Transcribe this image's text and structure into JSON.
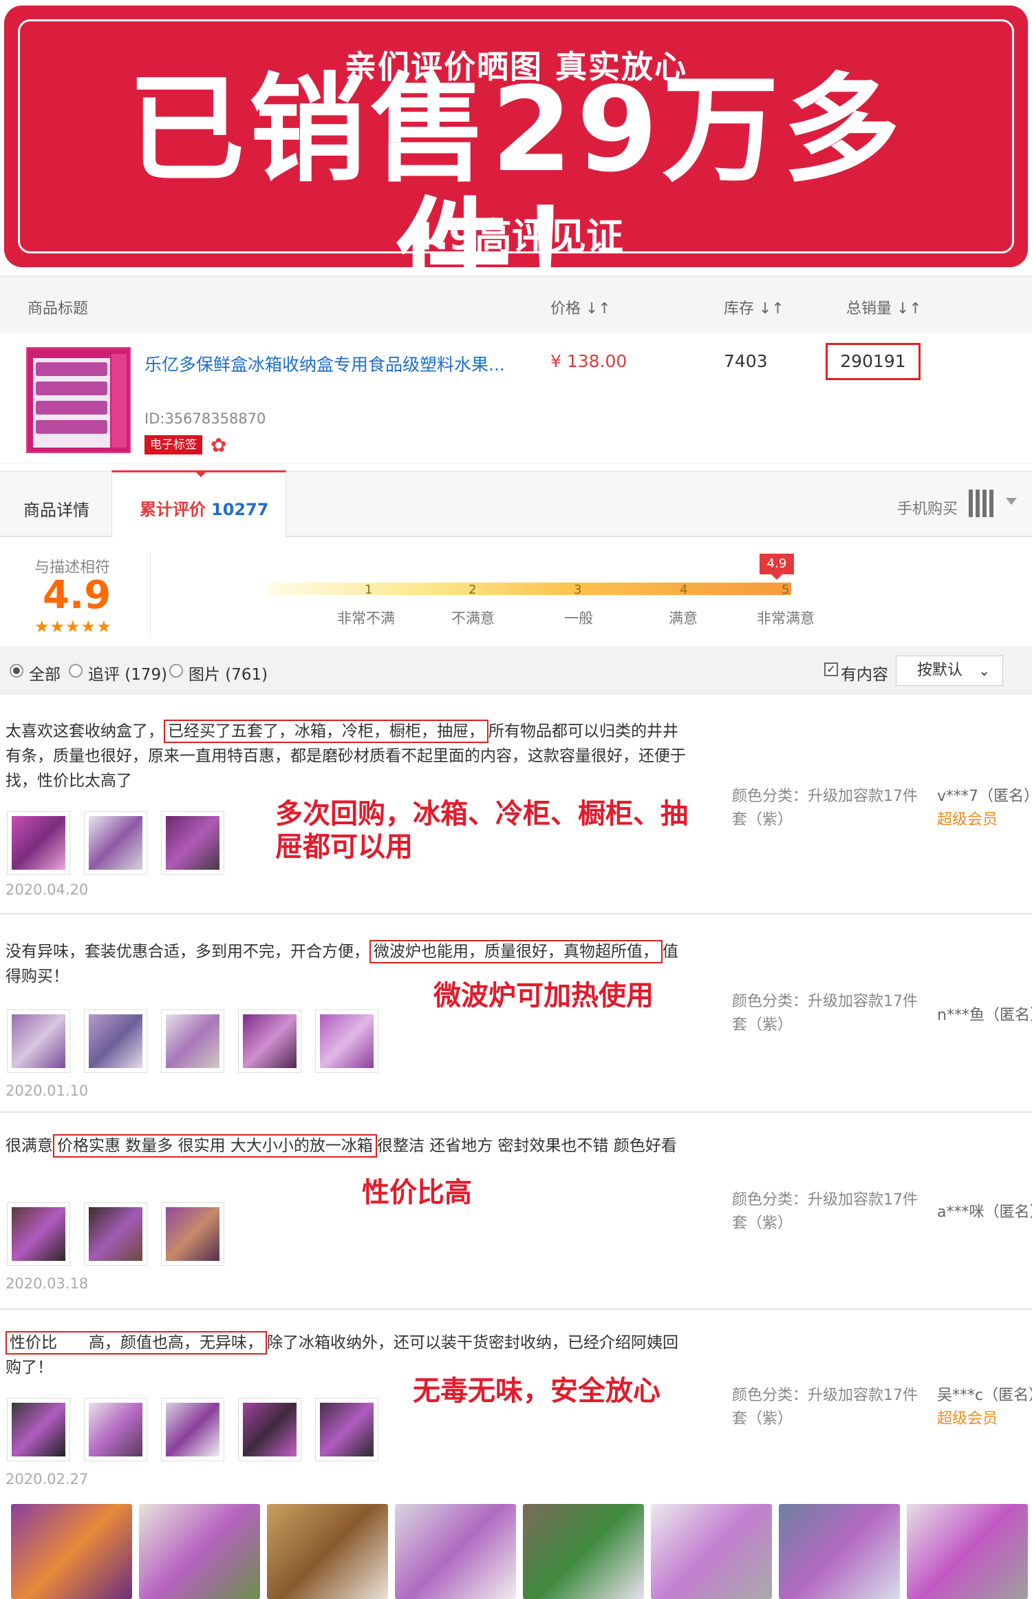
{
  "banner": {
    "subtitle": "亲们评价晒图 真实放心",
    "title": "已销售29万多件！",
    "footer": "4.9高评见证",
    "color": "#dc1e3e"
  },
  "table": {
    "headers": [
      "商品标题",
      "价格 ↓↑",
      "库存 ↓↑",
      "总销量 ↓↑"
    ],
    "product": {
      "title": "乐亿多保鲜盒冰箱收纳盒专用食品级塑料水果...",
      "price": "¥ 138.00",
      "stock": "7403",
      "sales": "290191",
      "id": "ID:35678358870",
      "tag": "电子标签",
      "flower_icon": "flower-icon"
    }
  },
  "tabs": {
    "details": "商品详情",
    "reviews_label": "累计评价",
    "reviews_count": "10277",
    "mobile_buy": "手机购买",
    "qr_icon": "qr-code-icon"
  },
  "rating": {
    "label": "与描述相符",
    "score": "4.9",
    "stars": "★★★★★",
    "badge": "4.9",
    "scale_numbers": [
      "1",
      "2",
      "3",
      "4",
      "5"
    ],
    "scale_words": [
      "非常不满",
      "不满意",
      "一般",
      "满意",
      "非常满意"
    ]
  },
  "filter": {
    "all": "全部",
    "followup": "追评 (179)",
    "images": "图片 (761)",
    "has_content": "有内容",
    "sort": "按默认"
  },
  "reviews": [
    {
      "text_before": "太喜欢这套收纳盒了，",
      "text_highlight": "已经买了五套了，冰箱，冷柜，橱柜，抽屉，",
      "text_after": "所有物品都可以归类的井井有条，质量也很好，原来一直用特百惠，都是磨砂材质看不起里面的内容，这款容量很好，还便于找，性价比太高了",
      "callout": "多次回购，冰箱、冷柜、橱柜、抽屉都可以用",
      "date": "2020.04.20",
      "spec": "颜色分类：升级加容款17件套（紫）",
      "user": "v***7（匿名）",
      "vip": "超级会员",
      "thumb_count": 3
    },
    {
      "text_before": "没有异味，套装优惠合适，多到用不完，开合方便，",
      "text_highlight": "微波炉也能用，质量很好，真物超所值，",
      "text_after": "值得购买！",
      "callout": "微波炉可加热使用",
      "date": "2020.01.10",
      "spec": "颜色分类：升级加容款17件套（紫）",
      "user": "n***鱼（匿名）",
      "vip": "",
      "thumb_count": 5
    },
    {
      "text_before": "很满意",
      "text_highlight": "价格实惠 数量多 很实用 大大小小的放一冰箱",
      "text_after": "很整洁 还省地方 密封效果也不错 颜色好看",
      "callout": "性价比高",
      "date": "2020.03.18",
      "spec": "颜色分类：升级加容款17件套（紫）",
      "user": "a***咪（匿名）",
      "vip": "",
      "thumb_count": 3
    },
    {
      "text_before": "",
      "text_highlight": "性价比　　高，颜值也高，无异味，",
      "text_after": "除了冰箱收纳外，还可以装干货密封收纳，已经介绍阿姨回购了！",
      "callout": "无毒无味，安全放心",
      "date": "2020.02.27",
      "spec": "颜色分类：升级加容款17件套（紫）",
      "user": "吴***c（匿名）",
      "vip": "超级会员",
      "thumb_count": 5
    }
  ]
}
